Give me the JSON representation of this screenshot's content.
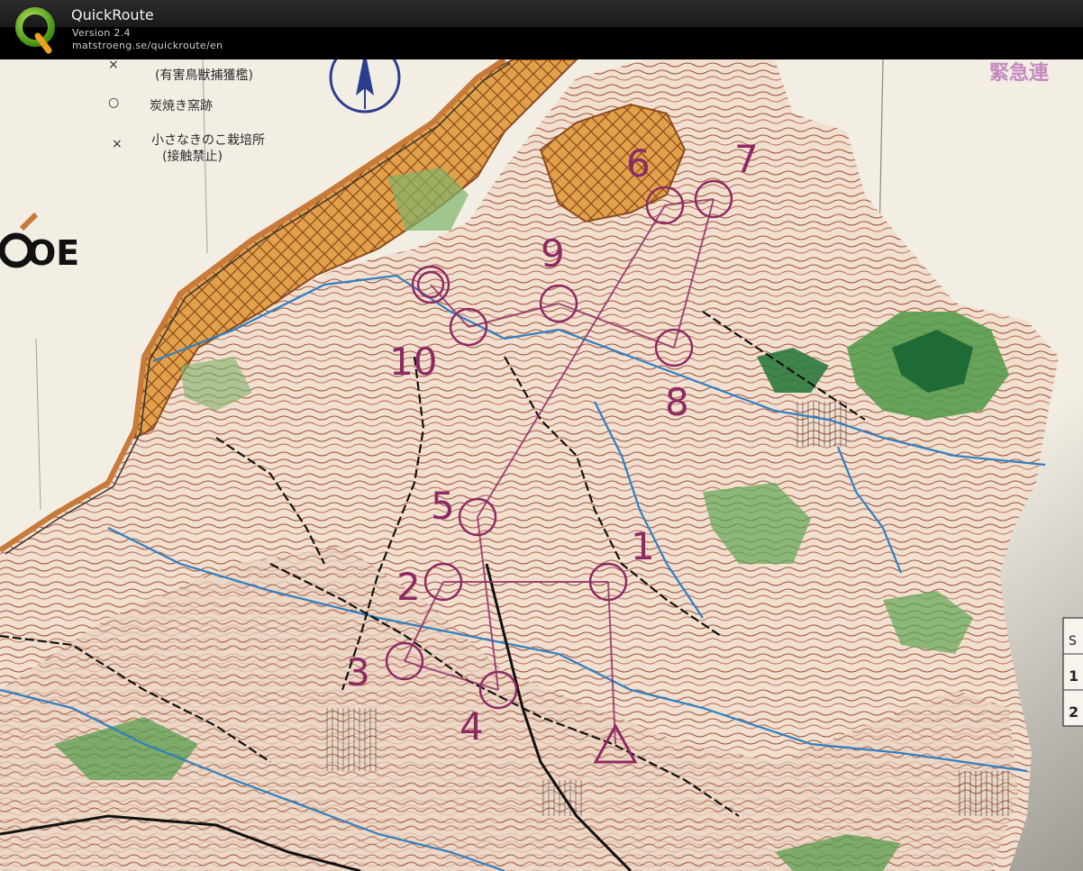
{
  "app": {
    "title": "QuickRoute",
    "version": "Version 2.4",
    "url": "matstroeng.se/quickroute/en"
  },
  "legend": [
    {
      "symbol": "×",
      "label": "(有害鳥獣捕獲檻)"
    },
    {
      "symbol": "○",
      "label": "炭焼き窯跡"
    },
    {
      "symbol": "×",
      "label": "小さなきのこ栽培所"
    },
    {
      "symbol": "",
      "label": "(接触禁止)"
    }
  ],
  "side_logo_text": "OE",
  "top_right_text": "緊急連",
  "course": {
    "color": "#8e2a63",
    "controls": [
      {
        "label": "1"
      },
      {
        "label": "2"
      },
      {
        "label": "3"
      },
      {
        "label": "4"
      },
      {
        "label": "5"
      },
      {
        "label": "6"
      },
      {
        "label": "7"
      },
      {
        "label": "8"
      },
      {
        "label": "9"
      },
      {
        "label": "10"
      }
    ]
  },
  "table_fragments": [
    "S",
    "1",
    "2"
  ],
  "colors": {
    "paper": "#f3efe6",
    "contour": "#a0533a",
    "water": "#2f7fc1",
    "urban": "#e3a04a",
    "vegetation": "#4f9a46",
    "dark_vegetation": "#1f6b36",
    "course": "#8e2a63"
  }
}
